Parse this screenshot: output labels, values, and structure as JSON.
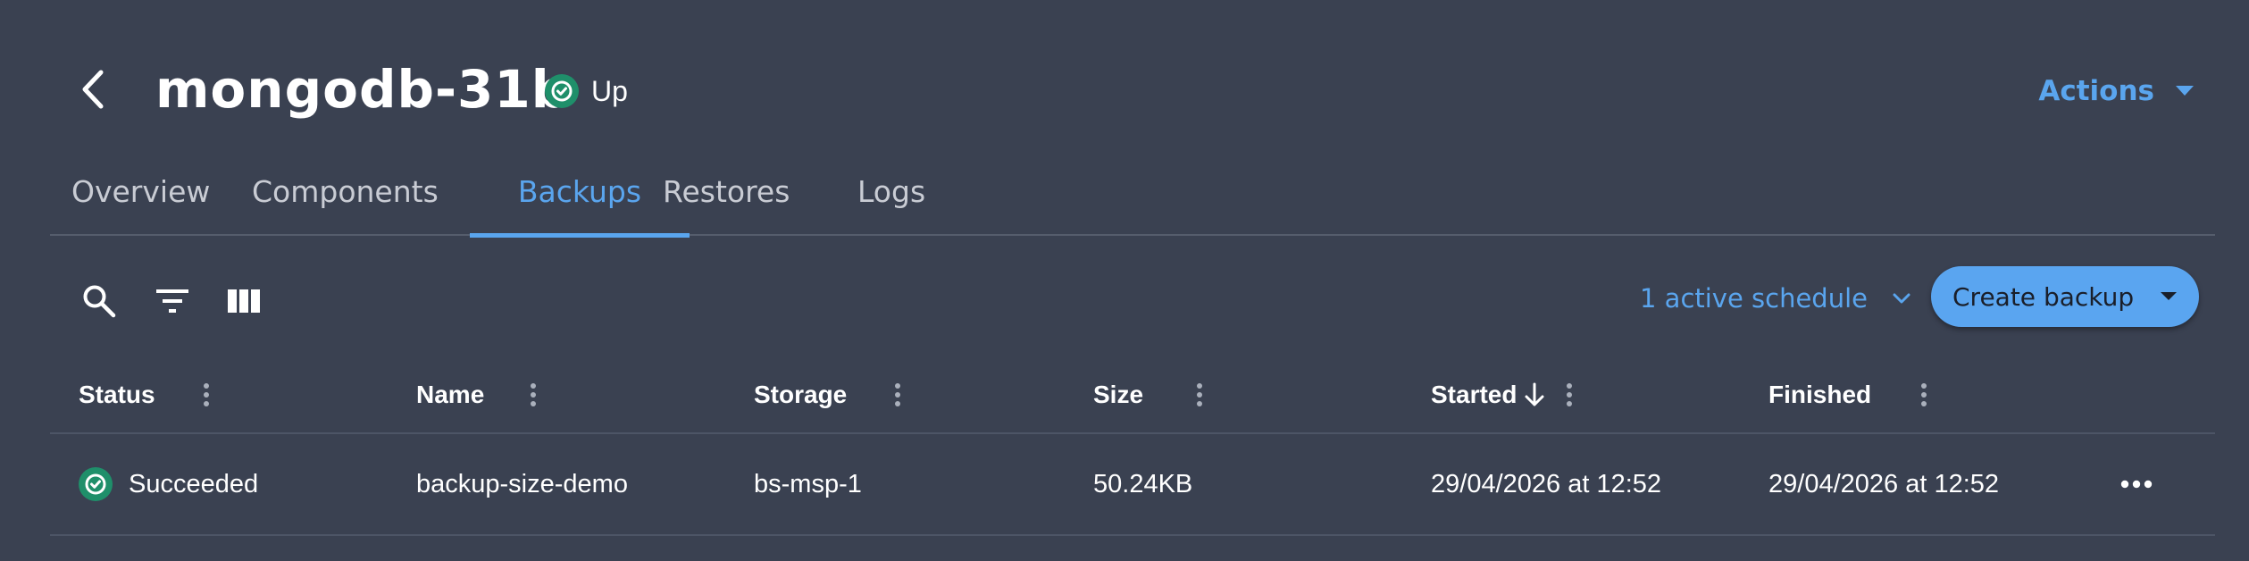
{
  "header": {
    "title": "mongodb-31b",
    "status": "Up",
    "actions_label": "Actions"
  },
  "tabs": [
    {
      "label": "Overview",
      "active": false
    },
    {
      "label": "Components",
      "active": false
    },
    {
      "label": "Backups",
      "active": true
    },
    {
      "label": "Restores",
      "active": false
    },
    {
      "label": "Logs",
      "active": false
    }
  ],
  "toolbar": {
    "icons": [
      "search-icon",
      "filter-icon",
      "columns-icon"
    ],
    "schedule_label": "1 active schedule",
    "create_label": "Create backup"
  },
  "table": {
    "columns": [
      {
        "label": "Status"
      },
      {
        "label": "Name"
      },
      {
        "label": "Storage"
      },
      {
        "label": "Size"
      },
      {
        "label": "Started",
        "sort": "desc"
      },
      {
        "label": "Finished"
      }
    ],
    "rows": [
      {
        "status": "Succeeded",
        "name": "backup-size-demo",
        "storage": "bs-msp-1",
        "size": "50.24KB",
        "started": "29/04/2026 at 12:52",
        "finished": "29/04/2026 at 12:52"
      }
    ]
  },
  "colors": {
    "background": "#3a4151",
    "accent": "#5aa5ee",
    "success": "#1f8f6a",
    "button": "#5aa5f0"
  }
}
